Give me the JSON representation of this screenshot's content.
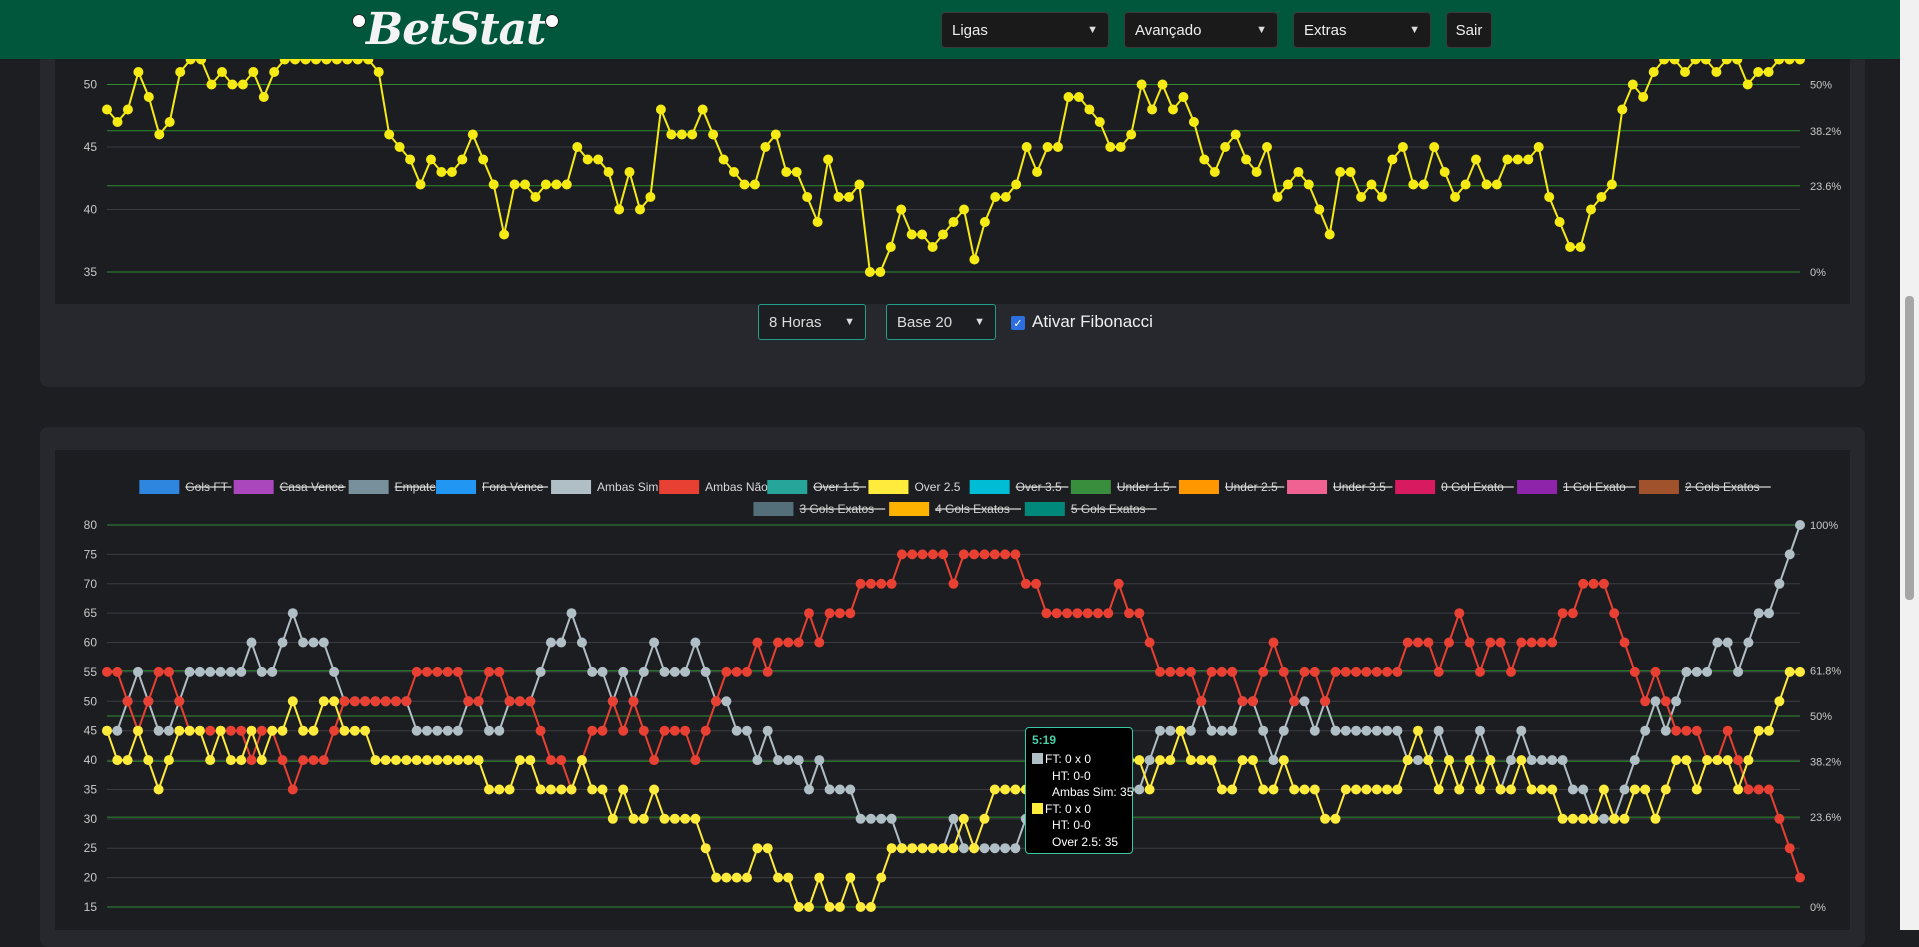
{
  "brand": {
    "name": "BetStat"
  },
  "nav": {
    "ligas": "Ligas",
    "avancado": "Avançado",
    "extras": "Extras",
    "sair": "Sair"
  },
  "controls": {
    "horas": "8 Horas",
    "base": "Base 20",
    "fibonacci_label": "Ativar Fibonacci",
    "fibonacci_checked": true
  },
  "colors": {
    "navbar": "#00573b",
    "accent": "#1f9e8a",
    "over25": "#f5ea14",
    "ambas_sim": "#b0bec5",
    "ambas_nao": "#e84033",
    "fib_line": "#2e8b2e"
  },
  "chart_data": [
    {
      "type": "line",
      "ylim": [
        35,
        51
      ],
      "yticks": [
        35,
        40,
        45,
        50
      ],
      "fib_levels": [
        {
          "label": "50%",
          "value": 50
        },
        {
          "label": "38.2%",
          "value": 46.3
        },
        {
          "label": "23.6%",
          "value": 41.9
        },
        {
          "label": "0%",
          "value": 35
        }
      ],
      "series": [
        {
          "color": "#f5ea14",
          "values": [
            48,
            47,
            48,
            51,
            49,
            46,
            47,
            51,
            52,
            52,
            50,
            51,
            50,
            50,
            51,
            49,
            51,
            52,
            52,
            52,
            52,
            52,
            52,
            52,
            52,
            52,
            51,
            46,
            45,
            44,
            42,
            44,
            43,
            43,
            44,
            46,
            44,
            42,
            38,
            42,
            42,
            41,
            42,
            42,
            42,
            45,
            44,
            44,
            43,
            40,
            43,
            40,
            41,
            48,
            46,
            46,
            46,
            48,
            46,
            44,
            43,
            42,
            42,
            45,
            46,
            43,
            43,
            41,
            39,
            44,
            41,
            41,
            42,
            35,
            35,
            37,
            40,
            38,
            38,
            37,
            38,
            39,
            40,
            36,
            39,
            41,
            41,
            42,
            45,
            43,
            45,
            45,
            49,
            49,
            48,
            47,
            45,
            45,
            46,
            50,
            48,
            50,
            48,
            49,
            47,
            44,
            43,
            45,
            46,
            44,
            43,
            45,
            41,
            42,
            43,
            42,
            40,
            38,
            43,
            43,
            41,
            42,
            41,
            44,
            45,
            42,
            42,
            45,
            43,
            41,
            42,
            44,
            42,
            42,
            44,
            44,
            44,
            45,
            41,
            39,
            37,
            37,
            40,
            41,
            42,
            48,
            50,
            49,
            51,
            52,
            52,
            51,
            52,
            52,
            51,
            52,
            52,
            50,
            51,
            51,
            52,
            52,
            52
          ]
        }
      ]
    },
    {
      "type": "line",
      "ylim": [
        15,
        80
      ],
      "yticks": [
        15,
        20,
        25,
        30,
        35,
        40,
        45,
        50,
        55,
        60,
        65,
        70,
        75,
        80
      ],
      "fib_levels": [
        {
          "label": "100%",
          "value": 80
        },
        {
          "label": "61.8%",
          "value": 55.2
        },
        {
          "label": "50%",
          "value": 47.5
        },
        {
          "label": "38.2%",
          "value": 39.8
        },
        {
          "label": "23.6%",
          "value": 30.3
        },
        {
          "label": "0%",
          "value": 15
        }
      ],
      "legend": [
        {
          "label": "Gols FT",
          "color": "#2e86de",
          "hidden": true
        },
        {
          "label": "Casa Vence",
          "color": "#ab47bc",
          "hidden": true
        },
        {
          "label": "Empate",
          "color": "#78909c",
          "hidden": true
        },
        {
          "label": "Fora Vence",
          "color": "#2196f3",
          "hidden": true
        },
        {
          "label": "Ambas Sim",
          "color": "#b0bec5",
          "hidden": false
        },
        {
          "label": "Ambas Não",
          "color": "#e84033",
          "hidden": false
        },
        {
          "label": "Over 1.5",
          "color": "#26a69a",
          "hidden": true
        },
        {
          "label": "Over 2.5",
          "color": "#ffeb3b",
          "hidden": false
        },
        {
          "label": "Over 3.5",
          "color": "#00bcd4",
          "hidden": true
        },
        {
          "label": "Under 1.5",
          "color": "#388e3c",
          "hidden": true
        },
        {
          "label": "Under 2.5",
          "color": "#ff9800",
          "hidden": true
        },
        {
          "label": "Under 3.5",
          "color": "#f06292",
          "hidden": true
        },
        {
          "label": "0 Gol Exato",
          "color": "#d81b60",
          "hidden": true
        },
        {
          "label": "1 Gol Exato",
          "color": "#8e24aa",
          "hidden": true
        },
        {
          "label": "2 Gols Exatos",
          "color": "#a0522d",
          "hidden": true
        },
        {
          "label": "3 Gols Exatos",
          "color": "#546e7a",
          "hidden": true
        },
        {
          "label": "4 Gols Exatos",
          "color": "#ffb300",
          "hidden": true
        },
        {
          "label": "5 Gols Exatos",
          "color": "#00897b",
          "hidden": true
        }
      ],
      "series": [
        {
          "name": "Ambas Sim",
          "color": "#b0bec5",
          "values": [
            45,
            45,
            50,
            55,
            50,
            45,
            45,
            50,
            55,
            55,
            55,
            55,
            55,
            55,
            60,
            55,
            55,
            60,
            65,
            60,
            60,
            60,
            55,
            50,
            50,
            50,
            50,
            50,
            50,
            50,
            45,
            45,
            45,
            45,
            45,
            50,
            50,
            45,
            45,
            50,
            50,
            50,
            55,
            60,
            60,
            65,
            60,
            55,
            55,
            50,
            55,
            50,
            55,
            60,
            55,
            55,
            55,
            60,
            55,
            50,
            50,
            45,
            45,
            40,
            45,
            40,
            40,
            40,
            35,
            40,
            35,
            35,
            35,
            30,
            30,
            30,
            30,
            25,
            25,
            25,
            25,
            25,
            30,
            25,
            25,
            25,
            25,
            25,
            25,
            30,
            30,
            35,
            35,
            35,
            35,
            35,
            35,
            35,
            30,
            35,
            35,
            40,
            45,
            45,
            45,
            45,
            50,
            45,
            45,
            45,
            50,
            50,
            45,
            40,
            45,
            50,
            50,
            45,
            50,
            45,
            45,
            45,
            45,
            45,
            45,
            45,
            40,
            40,
            40,
            45,
            40,
            35,
            40,
            45,
            40,
            35,
            40,
            45,
            40,
            40,
            40,
            40,
            35,
            35,
            30,
            30,
            30,
            35,
            40,
            45,
            50,
            45,
            50,
            55,
            55,
            55,
            60,
            60,
            55,
            60,
            65,
            65,
            70,
            75,
            80
          ]
        },
        {
          "name": "Ambas Não",
          "color": "#e84033",
          "values": [
            55,
            55,
            50,
            45,
            50,
            55,
            55,
            50,
            45,
            45,
            45,
            45,
            45,
            45,
            40,
            45,
            45,
            40,
            35,
            40,
            40,
            40,
            45,
            50,
            50,
            50,
            50,
            50,
            50,
            50,
            55,
            55,
            55,
            55,
            55,
            50,
            50,
            55,
            55,
            50,
            50,
            50,
            45,
            40,
            40,
            35,
            40,
            45,
            45,
            50,
            45,
            50,
            45,
            40,
            45,
            45,
            45,
            40,
            45,
            50,
            55,
            55,
            55,
            60,
            55,
            60,
            60,
            60,
            65,
            60,
            65,
            65,
            65,
            70,
            70,
            70,
            70,
            75,
            75,
            75,
            75,
            75,
            70,
            75,
            75,
            75,
            75,
            75,
            75,
            70,
            70,
            65,
            65,
            65,
            65,
            65,
            65,
            65,
            70,
            65,
            65,
            60,
            55,
            55,
            55,
            55,
            50,
            55,
            55,
            55,
            50,
            50,
            55,
            60,
            55,
            50,
            55,
            55,
            50,
            55,
            55,
            55,
            55,
            55,
            55,
            55,
            60,
            60,
            60,
            55,
            60,
            65,
            60,
            55,
            60,
            60,
            55,
            60,
            60,
            60,
            60,
            65,
            65,
            70,
            70,
            70,
            65,
            60,
            55,
            50,
            55,
            50,
            45,
            45,
            45,
            40,
            40,
            45,
            40,
            35,
            35,
            35,
            30,
            25,
            20
          ]
        },
        {
          "name": "Over 2.5",
          "color": "#ffeb3b",
          "values": [
            45,
            40,
            40,
            45,
            40,
            35,
            40,
            45,
            45,
            45,
            40,
            45,
            40,
            40,
            45,
            40,
            45,
            45,
            50,
            45,
            45,
            50,
            50,
            45,
            45,
            45,
            40,
            40,
            40,
            40,
            40,
            40,
            40,
            40,
            40,
            40,
            40,
            35,
            35,
            35,
            40,
            40,
            35,
            35,
            35,
            35,
            40,
            35,
            35,
            30,
            35,
            30,
            30,
            35,
            30,
            30,
            30,
            30,
            25,
            20,
            20,
            20,
            20,
            25,
            25,
            20,
            20,
            15,
            15,
            20,
            15,
            15,
            20,
            15,
            15,
            20,
            25,
            25,
            25,
            25,
            25,
            25,
            25,
            30,
            25,
            30,
            35,
            35,
            35,
            35,
            35,
            40,
            40,
            40,
            40,
            40,
            40,
            40,
            40,
            40,
            40,
            35,
            40,
            40,
            45,
            40,
            40,
            40,
            35,
            35,
            40,
            40,
            35,
            35,
            40,
            35,
            35,
            35,
            30,
            30,
            35,
            35,
            35,
            35,
            35,
            35,
            40,
            45,
            40,
            35,
            40,
            35,
            40,
            35,
            40,
            35,
            35,
            40,
            35,
            35,
            35,
            30,
            30,
            30,
            30,
            35,
            30,
            30,
            35,
            35,
            30,
            35,
            40,
            40,
            35,
            40,
            40,
            40,
            35,
            40,
            45,
            45,
            50,
            55,
            55
          ]
        }
      ],
      "tooltip": {
        "title": "5:19",
        "lines": [
          {
            "swatch": "#b0bec5",
            "text": "FT: 0 x 0"
          },
          {
            "swatch": "",
            "text": "HT: 0-0"
          },
          {
            "swatch": "",
            "text": "Ambas Sim: 35"
          },
          {
            "swatch": "#ffeb3b",
            "text": "FT: 0 x 0"
          },
          {
            "swatch": "",
            "text": "HT: 0-0"
          },
          {
            "swatch": "",
            "text": "Over 2.5: 35"
          }
        ]
      }
    }
  ]
}
